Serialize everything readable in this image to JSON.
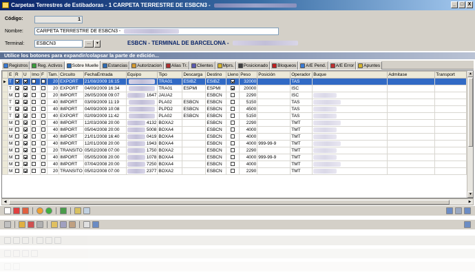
{
  "window": {
    "title": "Carpetas Terrestres de Estibadoras - 1  CARPETA TERRESTRE DE ESBCN3 -",
    "controls": [
      "_",
      "□",
      "X"
    ]
  },
  "form": {
    "codigo_label": "Código:",
    "codigo_value": "1",
    "nombre_label": "Nombre:",
    "nombre_value": "CARPETA TERRESTRE DE ESBCN3 -",
    "terminal_label": "Terminal:",
    "terminal_value": "ESBCN3",
    "lookup_button": "...",
    "terminal_name": "ESBCN - TERMINAL DE BARCELONA -"
  },
  "info_bar": "Utilice los botones para expandir/colapsar la parte de edición...",
  "tabs": [
    {
      "label": "Registros",
      "color": "#3a7bd5"
    },
    {
      "label": "Reg. Activos",
      "color": "#3a9d3a"
    },
    {
      "label": "Sobre Muelle",
      "color": "#2f6db5",
      "active": true
    },
    {
      "label": "Estancias",
      "color": "#2f6db5"
    },
    {
      "label": "Autorizacion",
      "color": "#d59a2f"
    },
    {
      "label": "Alias Tr.",
      "color": "#b03030"
    },
    {
      "label": "Clientes",
      "color": "#5a5ab0"
    },
    {
      "label": "Mprs.",
      "color": "#d5b52f"
    },
    {
      "label": "Posicionado",
      "color": "#404040"
    },
    {
      "label": "Bloqueos",
      "color": "#c02020"
    },
    {
      "label": "A/E Pend.",
      "color": "#3a7bd5"
    },
    {
      "label": "A/E Error",
      "color": "#c03030"
    },
    {
      "label": "Apuntes",
      "color": "#d5b52f"
    }
  ],
  "grid": {
    "headers": [
      "E",
      "R",
      "U",
      "Imo",
      "F",
      "Tam.",
      "Circuito",
      "FechaEntrada",
      "Equipo",
      "Tipo",
      "Descarga",
      "Destino",
      "Lleno",
      "Peso",
      "Posición",
      "Operador",
      "Buque",
      "Admitase",
      "Transport"
    ],
    "rows": [
      {
        "E": "T",
        "R": true,
        "U": true,
        "Imo": false,
        "F": false,
        "Tam": "20",
        "Circuito": "EXPORT",
        "FechaEntrada": "21/08/2009 16:15",
        "Equipo": "",
        "Tipo": "TRA01",
        "Descarga": "ESIBZ",
        "Destino": "ESIBZ",
        "Lleno": true,
        "Peso": "32000",
        "Posicion": "",
        "Operador": "TAS",
        "selected": true
      },
      {
        "E": "T",
        "R": true,
        "U": true,
        "Imo": false,
        "F": false,
        "Tam": "20",
        "Circuito": "EXPORT",
        "FechaEntrada": "04/09/2009 16:34",
        "Equipo": "",
        "Tipo": "TRA01",
        "Descarga": "ESPMI",
        "Destino": "ESPMI",
        "Lleno": true,
        "Peso": "20000",
        "Posicion": "",
        "Operador": "ISC"
      },
      {
        "E": "M",
        "R": false,
        "U": true,
        "Imo": false,
        "F": false,
        "Tam": "20",
        "Circuito": "IMPORT",
        "FechaEntrada": "26/05/2008 09:07",
        "Equipo": "1647",
        "Tipo": "JAUA2",
        "Descarga": "",
        "Destino": "ESBCN",
        "Lleno": false,
        "Peso": "2290",
        "Posicion": "",
        "Operador": "ISC"
      },
      {
        "E": "T",
        "R": true,
        "U": true,
        "Imo": false,
        "F": false,
        "Tam": "40",
        "Circuito": "IMPORT",
        "FechaEntrada": "03/09/2009 11:19",
        "Equipo": "",
        "Tipo": "PLA02",
        "Descarga": "ESBCN",
        "Destino": "ESBCN",
        "Lleno": false,
        "Peso": "5150",
        "Posicion": "",
        "Operador": "TAS"
      },
      {
        "E": "T",
        "R": true,
        "U": true,
        "Imo": false,
        "F": false,
        "Tam": "40",
        "Circuito": "IMPORT",
        "FechaEntrada": "04/09/2009 10:08",
        "Equipo": "",
        "Tipo": "PLPD2",
        "Descarga": "ESBCN",
        "Destino": "ESBCN",
        "Lleno": false,
        "Peso": "4500",
        "Posicion": "",
        "Operador": "TAS"
      },
      {
        "E": "T",
        "R": true,
        "U": true,
        "Imo": false,
        "F": false,
        "Tam": "40",
        "Circuito": "EXPORT",
        "FechaEntrada": "02/09/2009 11:42",
        "Equipo": "",
        "Tipo": "PLA02",
        "Descarga": "ESBCN",
        "Destino": "ESBCN",
        "Lleno": false,
        "Peso": "5150",
        "Posicion": "",
        "Operador": "TAS"
      },
      {
        "E": "M",
        "R": false,
        "U": true,
        "Imo": false,
        "F": false,
        "Tam": "40",
        "Circuito": "IMPORT",
        "FechaEntrada": "12/03/2008 20:00",
        "Equipo": "4132",
        "Tipo": "BOXA2",
        "Descarga": "",
        "Destino": "ESBCN",
        "Lleno": false,
        "Peso": "2290",
        "Posicion": "",
        "Operador": "TMT"
      },
      {
        "E": "M",
        "R": false,
        "U": true,
        "Imo": false,
        "F": false,
        "Tam": "40",
        "Circuito": "IMPORT",
        "FechaEntrada": "05/04/2008 20:00",
        "Equipo": "5008",
        "Tipo": "BOXA4",
        "Descarga": "",
        "Destino": "ESBCN",
        "Lleno": false,
        "Peso": "4000",
        "Posicion": "",
        "Operador": "TMT"
      },
      {
        "E": "M",
        "R": false,
        "U": true,
        "Imo": false,
        "F": false,
        "Tam": "40",
        "Circuito": "IMPORT",
        "FechaEntrada": "21/01/2008 16:40",
        "Equipo": "0419",
        "Tipo": "BOXA4",
        "Descarga": "",
        "Destino": "ESBCN",
        "Lleno": false,
        "Peso": "4000",
        "Posicion": "",
        "Operador": "TMT"
      },
      {
        "E": "M",
        "R": false,
        "U": true,
        "Imo": false,
        "F": false,
        "Tam": "40",
        "Circuito": "IMPORT",
        "FechaEntrada": "12/01/2008 20:00",
        "Equipo": "1943",
        "Tipo": "BOXA4",
        "Descarga": "",
        "Destino": "ESBCN",
        "Lleno": false,
        "Peso": "4000",
        "Posicion": "999-99-9",
        "Operador": "TMT"
      },
      {
        "E": "M",
        "R": false,
        "U": true,
        "Imo": false,
        "F": false,
        "Tam": "20",
        "Circuito": "TRANSITO",
        "FechaEntrada": "05/02/2008 07:00",
        "Equipo": "1750",
        "Tipo": "BOXA2",
        "Descarga": "",
        "Destino": "ESBCN",
        "Lleno": false,
        "Peso": "2290",
        "Posicion": "",
        "Operador": "TMT"
      },
      {
        "E": "M",
        "R": false,
        "U": true,
        "Imo": false,
        "F": false,
        "Tam": "40",
        "Circuito": "IMPORT",
        "FechaEntrada": "05/05/2008 20:00",
        "Equipo": "1078",
        "Tipo": "BOXA4",
        "Descarga": "",
        "Destino": "ESBCN",
        "Lleno": false,
        "Peso": "4000",
        "Posicion": "999-99-9",
        "Operador": "TMT"
      },
      {
        "E": "M",
        "R": false,
        "U": true,
        "Imo": false,
        "F": false,
        "Tam": "40",
        "Circuito": "IMPORT",
        "FechaEntrada": "07/04/2008 20:00",
        "Equipo": "7250",
        "Tipo": "BOXA4",
        "Descarga": "",
        "Destino": "ESBCN",
        "Lleno": false,
        "Peso": "4000",
        "Posicion": "",
        "Operador": "TMT"
      },
      {
        "E": "M",
        "R": false,
        "U": true,
        "Imo": false,
        "F": false,
        "Tam": "20",
        "Circuito": "TRANSITO",
        "FechaEntrada": "05/02/2008 07:00",
        "Equipo": "2377",
        "Tipo": "BOXA2",
        "Descarga": "",
        "Destino": "ESBCN",
        "Lleno": false,
        "Peso": "2290",
        "Posicion": "",
        "Operador": "TMT"
      }
    ]
  },
  "colors": {
    "selection": "#316ac5",
    "titlebar": "#0a246a",
    "terminal_name": "#0a246a"
  }
}
